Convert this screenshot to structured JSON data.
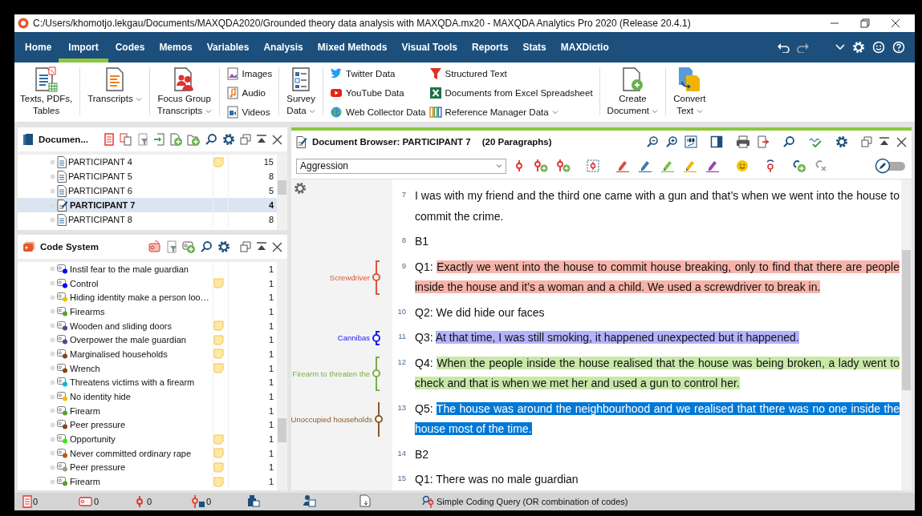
{
  "window": {
    "title": "C:/Users/khomotjo.lekgau/Documents/MAXQDA2020/Grounded theory data analysis with MAXQDA.mx20 - MAXQDA Analytics Pro 2020 (Release 20.4.1)"
  },
  "menu_tabs": [
    {
      "label": "Home",
      "selected": false
    },
    {
      "label": "Import",
      "selected": true
    },
    {
      "label": "Codes",
      "selected": false
    },
    {
      "label": "Memos",
      "selected": false
    },
    {
      "label": "Variables",
      "selected": false
    },
    {
      "label": "Analysis",
      "selected": false
    },
    {
      "label": "Mixed Methods",
      "selected": false
    },
    {
      "label": "Visual Tools",
      "selected": false
    },
    {
      "label": "Reports",
      "selected": false
    },
    {
      "label": "Stats",
      "selected": false
    },
    {
      "label": "MAXDictio",
      "selected": false
    }
  ],
  "ribbon": [
    {
      "kind": "large",
      "label": "Texts, PDFs,\nTables",
      "dropdown": false
    },
    {
      "kind": "large",
      "label": "Transcripts",
      "dropdown": true
    },
    {
      "kind": "large",
      "label": "Focus Group\nTranscripts",
      "dropdown": true
    },
    {
      "kind": "stack",
      "items": [
        {
          "label": "Images",
          "dropdown": false
        },
        {
          "label": "Audio",
          "dropdown": false
        },
        {
          "label": "Videos",
          "dropdown": false
        }
      ]
    },
    {
      "kind": "large",
      "label": "Survey\nData",
      "dropdown": true
    },
    {
      "kind": "stack",
      "items": [
        {
          "label": "Twitter Data",
          "dropdown": false
        },
        {
          "label": "YouTube Data",
          "dropdown": false
        },
        {
          "label": "Web Collector Data",
          "dropdown": false
        }
      ]
    },
    {
      "kind": "stack",
      "items": [
        {
          "label": "Structured Text",
          "dropdown": false
        },
        {
          "label": "Documents from Excel Spreadsheet",
          "dropdown": false
        },
        {
          "label": "Reference Manager Data",
          "dropdown": true
        }
      ]
    },
    {
      "kind": "large",
      "label": "Create\nDocument",
      "dropdown": true
    },
    {
      "kind": "large",
      "label": "Convert\nText",
      "dropdown": true
    }
  ],
  "document_system": {
    "title": "Documen...",
    "rows": [
      {
        "label": "PARTICIPANT 4",
        "memo": true,
        "count": "15",
        "selected": false
      },
      {
        "label": "PARTICIPANT 5",
        "memo": false,
        "count": "8",
        "selected": false
      },
      {
        "label": "PARTICIPANT 6",
        "memo": false,
        "count": "5",
        "selected": false
      },
      {
        "label": "PARTICIPANT 7",
        "memo": false,
        "count": "4",
        "selected": true
      },
      {
        "label": "PARTICIPANT 8",
        "memo": false,
        "count": "8",
        "selected": false
      }
    ]
  },
  "code_system": {
    "title": "Code System",
    "codes": [
      {
        "label": "Instil fear to the male guardian",
        "color": "#0000ff",
        "memo": false,
        "count": "1"
      },
      {
        "label": "Control",
        "color": "#0000ff",
        "memo": true,
        "count": "1"
      },
      {
        "label": "Hiding identity make a person loo…",
        "color": "#f0c000",
        "memo": false,
        "count": "1"
      },
      {
        "label": "Firearms",
        "color": "#5aa02c",
        "memo": false,
        "count": "1"
      },
      {
        "label": "Wooden and sliding doors",
        "color": "#4b4b8c",
        "memo": true,
        "count": "1"
      },
      {
        "label": "Overpower the male guardian",
        "color": "#4b4b8c",
        "memo": true,
        "count": "1"
      },
      {
        "label": "Marginalised households",
        "color": "#8b4513",
        "memo": true,
        "count": "1"
      },
      {
        "label": "Wrench",
        "color": "#8b4513",
        "memo": true,
        "count": "1"
      },
      {
        "label": "Threatens victims with a firearm",
        "color": "#00bcd4",
        "memo": false,
        "count": "1"
      },
      {
        "label": "No identity hide",
        "color": "#f0c000",
        "memo": false,
        "count": "1"
      },
      {
        "label": "Firearm",
        "color": "#5aa02c",
        "memo": false,
        "count": "1"
      },
      {
        "label": "Peer pressure",
        "color": "#8b4513",
        "memo": false,
        "count": "1"
      },
      {
        "label": "Opportunity",
        "color": "#33ee00",
        "memo": true,
        "count": "1"
      },
      {
        "label": "Never committed ordinary rape",
        "color": "#c0580a",
        "memo": true,
        "count": "1"
      },
      {
        "label": "Peer pressure",
        "color": "#a0a080",
        "memo": true,
        "count": "1"
      },
      {
        "label": "Firearm",
        "color": "#5aa02c",
        "memo": true,
        "count": "1"
      }
    ]
  },
  "document_browser": {
    "title": "Document Browser: PARTICIPANT 7",
    "subtitle": "(20 Paragraphs)",
    "code_dropdown": {
      "value": "Aggression"
    },
    "edit_mode": false,
    "paragraphs": [
      {
        "number": "7",
        "text": "I was with my friend and the third one came with a gun and that’s when we went into the house to commit the crime.",
        "selected": false
      },
      {
        "number": "8",
        "text": "B1",
        "selected": false
      },
      {
        "number": "9",
        "prefix": "Q1: ",
        "text": "Exactly we went into the house to commit house breaking, only to find that there are people inside the house and it’s a woman and a child. We used a screwdriver to break in.",
        "color": "#f8b4aa",
        "selected": false,
        "coding": {
          "label": "Screwdriver",
          "color": "#e0533a"
        }
      },
      {
        "number": "10",
        "text": "Q2: We did hide our faces",
        "selected": false
      },
      {
        "number": "11",
        "prefix": "Q3: ",
        "text": "At that time, I was still smoking, it happened unexpected but it happened.",
        "color": "#b4b2fb",
        "selected": false,
        "coding": {
          "label": "Cannibas",
          "color": "#1a1aff"
        }
      },
      {
        "number": "12",
        "prefix": "Q4: ",
        "text": "When the people inside the house realised that the house was being broken, a lady went to check and that is when we met her and used a gun to control her.",
        "color": "#c8e8a8",
        "selected": false,
        "coding": {
          "label": "Firearm to threaten the",
          "color": "#78b048"
        }
      },
      {
        "number": "13",
        "prefix": "Q5: ",
        "text": "The house was around the neighbourhood and we realised that there was no one inside the house most of the time.",
        "selected": true,
        "coding": {
          "label": "Unoccupied households",
          "color": "#8b5a2b"
        }
      },
      {
        "number": "14",
        "text": "B2",
        "selected": false
      },
      {
        "number": "15",
        "text": "Q1: There was no male guardian",
        "selected": false
      }
    ]
  },
  "status_bar": {
    "counts": [
      "0",
      "0",
      "0",
      "0"
    ],
    "query": "Simple Coding Query (OR combination of codes)"
  }
}
